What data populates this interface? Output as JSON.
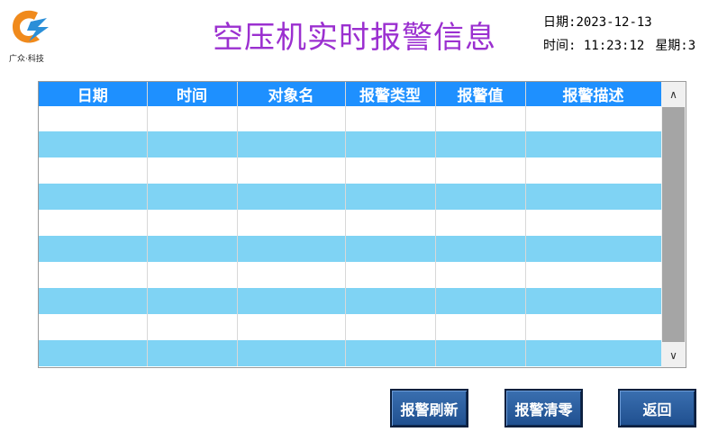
{
  "logo": {
    "text": "广众·科技"
  },
  "title": "空压机实时报警信息",
  "datetime": {
    "date_label": "日期:",
    "date_value": "2023-12-13",
    "time_label": "时间:",
    "time_value": "11:23:12",
    "weekday_label": "星期:",
    "weekday_value": "3"
  },
  "table": {
    "columns": [
      "日期",
      "时间",
      "对象名",
      "报警类型",
      "报警值",
      "报警描述"
    ],
    "rows": [
      [
        "",
        "",
        "",
        "",
        "",
        ""
      ],
      [
        "",
        "",
        "",
        "",
        "",
        ""
      ],
      [
        "",
        "",
        "",
        "",
        "",
        ""
      ],
      [
        "",
        "",
        "",
        "",
        "",
        ""
      ],
      [
        "",
        "",
        "",
        "",
        "",
        ""
      ],
      [
        "",
        "",
        "",
        "",
        "",
        ""
      ],
      [
        "",
        "",
        "",
        "",
        "",
        ""
      ],
      [
        "",
        "",
        "",
        "",
        "",
        ""
      ],
      [
        "",
        "",
        "",
        "",
        "",
        ""
      ],
      [
        "",
        "",
        "",
        "",
        "",
        ""
      ]
    ]
  },
  "scrollbar": {
    "up_icon": "chevron-up-icon",
    "down_icon": "chevron-down-icon"
  },
  "buttons": {
    "refresh": "报警刷新",
    "clear": "报警清零",
    "back": "返回"
  },
  "colors": {
    "title": "#9b30d0",
    "header_bg": "#1e90ff",
    "row_alt": "#7fd3f4",
    "button_bg": "#2a5fa0"
  }
}
